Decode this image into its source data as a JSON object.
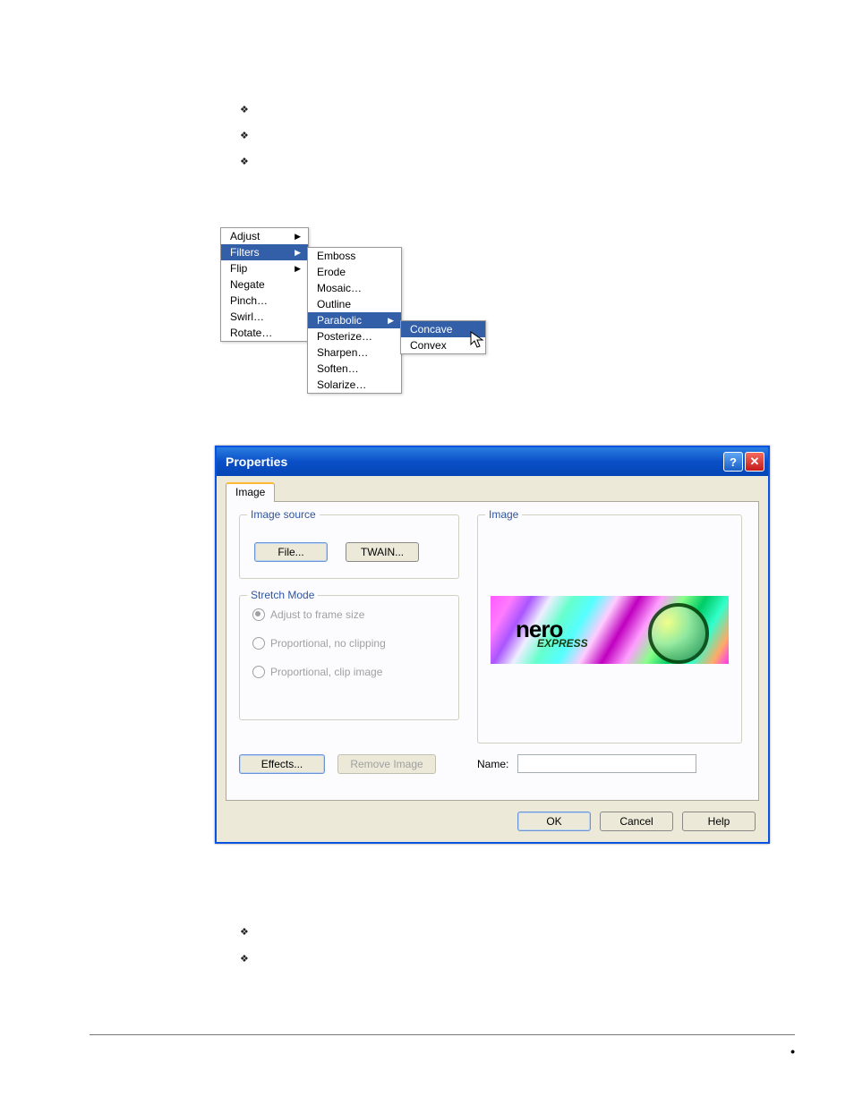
{
  "top_bullets": {
    "b1": "",
    "b2": "",
    "b3": ""
  },
  "menu1": {
    "items": [
      {
        "label": "Adjust",
        "submenu": true,
        "selected": false
      },
      {
        "label": "Filters",
        "submenu": true,
        "selected": true
      },
      {
        "label": "Flip",
        "submenu": true,
        "selected": false
      },
      {
        "label": "Negate",
        "submenu": false,
        "selected": false
      },
      {
        "label": "Pinch…",
        "submenu": false,
        "selected": false
      },
      {
        "label": "Swirl…",
        "submenu": false,
        "selected": false
      },
      {
        "label": "Rotate…",
        "submenu": false,
        "selected": false
      }
    ]
  },
  "menu2": {
    "items": [
      {
        "label": "Emboss",
        "submenu": false,
        "selected": false
      },
      {
        "label": "Erode",
        "submenu": false,
        "selected": false
      },
      {
        "label": "Mosaic…",
        "submenu": false,
        "selected": false
      },
      {
        "label": "Outline",
        "submenu": false,
        "selected": false
      },
      {
        "label": "Parabolic",
        "submenu": true,
        "selected": true
      },
      {
        "label": "Posterize…",
        "submenu": false,
        "selected": false
      },
      {
        "label": "Sharpen…",
        "submenu": false,
        "selected": false
      },
      {
        "label": "Soften…",
        "submenu": false,
        "selected": false
      },
      {
        "label": "Solarize…",
        "submenu": false,
        "selected": false
      }
    ]
  },
  "menu3": {
    "items": [
      {
        "label": "Concave",
        "selected": true
      },
      {
        "label": "Convex",
        "selected": false
      }
    ]
  },
  "dialog": {
    "title": "Properties",
    "tab_label": "Image",
    "group_image_source": "Image source",
    "btn_file": "File...",
    "btn_twain": "TWAIN...",
    "group_stretch": "Stretch Mode",
    "radios": [
      "Adjust to frame size",
      "Proportional, no clipping",
      "Proportional, clip image"
    ],
    "btn_effects": "Effects...",
    "btn_remove": "Remove Image",
    "group_image": "Image",
    "preview_brand1": "nero",
    "preview_brand2": "EXPRESS",
    "name_label": "Name:",
    "name_value": "",
    "btn_ok": "OK",
    "btn_cancel": "Cancel",
    "btn_help": "Help"
  },
  "bottom_bullets": {
    "b1": "",
    "b2": ""
  }
}
